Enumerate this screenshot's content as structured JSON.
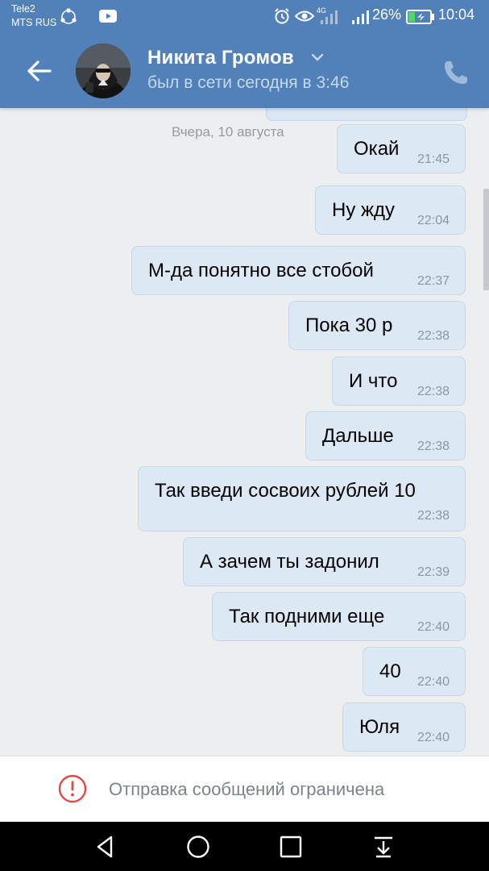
{
  "status_bar": {
    "carrier_1": "Tele2",
    "carrier_2": "MTS RUS",
    "network_label": "4G",
    "battery_percent": "26%",
    "clock": "10:04",
    "icons": [
      "share-icon",
      "youtube-icon",
      "alarm-icon",
      "eye-icon",
      "signal-icon",
      "battery-icon"
    ]
  },
  "header": {
    "contact_name": "Никита Громов",
    "contact_status": "был в сети сегодня в 3:46",
    "colors": {
      "background": "#5181b8",
      "status_text": "#c6d8ee"
    }
  },
  "chat": {
    "date_separator": "Вчера, 10 августа",
    "bubble_color": "#dde8f5",
    "messages": [
      {
        "text": "Окай",
        "time": "21:45"
      },
      {
        "text": "Ну жду",
        "time": "22:04"
      },
      {
        "text": "М-да понятно все стобой",
        "time": "22:37"
      },
      {
        "text": "Пока 30 р",
        "time": "22:38"
      },
      {
        "text": "И что",
        "time": "22:38"
      },
      {
        "text": "Дальше",
        "time": "22:38"
      },
      {
        "text": "Так введи сосвоих рублей 10",
        "time": "22:38"
      },
      {
        "text": "А зачем ты задонил",
        "time": "22:39"
      },
      {
        "text": "Так подними еще",
        "time": "22:40"
      },
      {
        "text": "40",
        "time": "22:40"
      },
      {
        "text": "Юля",
        "time": "22:40"
      }
    ]
  },
  "footer": {
    "restriction_text": "Отправка сообщений ограничена",
    "alert_color": "#e64646"
  },
  "navbar": {
    "icons": [
      "back-triangle-icon",
      "home-circle-icon",
      "recents-square-icon",
      "notification-pull-icon"
    ]
  }
}
